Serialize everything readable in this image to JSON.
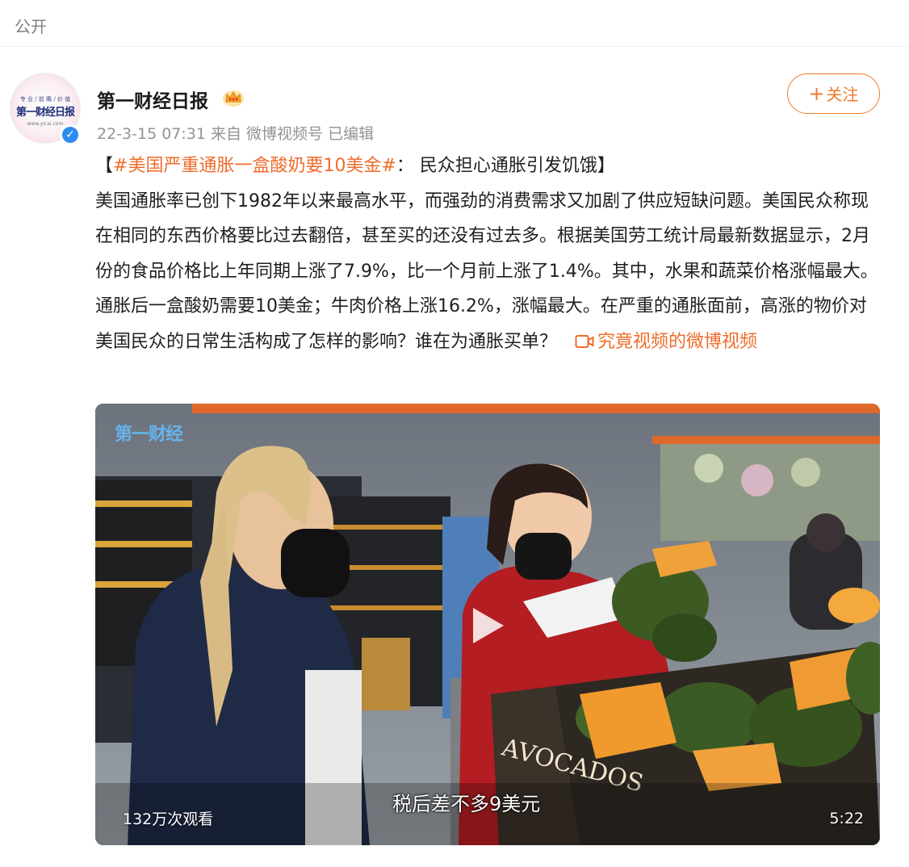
{
  "header": {
    "visibility": "公开"
  },
  "post": {
    "author": "第一财经日报",
    "avatar": {
      "small_text": "专 业 / 前 瞻 / 价 值",
      "brand_text": "第一财经日报",
      "url_text": "www.yicai.com"
    },
    "meta": "22-3-15 07:31 来自 微博视频号 已编辑",
    "follow_label": "关注",
    "content": {
      "open_bracket": "【",
      "hashtag": "#美国严重通胀一盒酸奶要10美金#",
      "headline_rest": "： 民众担心通胀引发饥饿】",
      "body": "美国通胀率已创下1982年以来最高水平，而强劲的消费需求又加剧了供应短缺问题。美国民众称现在相同的东西价格要比过去翻倍，甚至买的还没有过去多。根据美国劳工统计局最新数据显示，2月份的食品价格比上年同期上涨了7.9%，比一个月前上涨了1.4%。其中，水果和蔬菜价格涨幅最大。通胀后一盒酸奶需要10美金；牛肉价格上涨16.2%，涨幅最大。在严重的通胀面前，高涨的物价对美国民众的日常生活构成了怎样的影响？谁在为通胀买单？",
      "video_link": "究竟视频的微博视频"
    },
    "video": {
      "watermark": "第一财经",
      "views": "132万次观看",
      "subtitle": "税后差不多9美元",
      "duration": "5:22",
      "box_label": "AVOCADOS"
    }
  },
  "colors": {
    "accent": "#ef6c2b",
    "verify": "#2d8cf0",
    "meta": "#939393"
  },
  "icons": [
    "crown-icon",
    "verified-icon",
    "video-link-icon",
    "play-icon"
  ]
}
